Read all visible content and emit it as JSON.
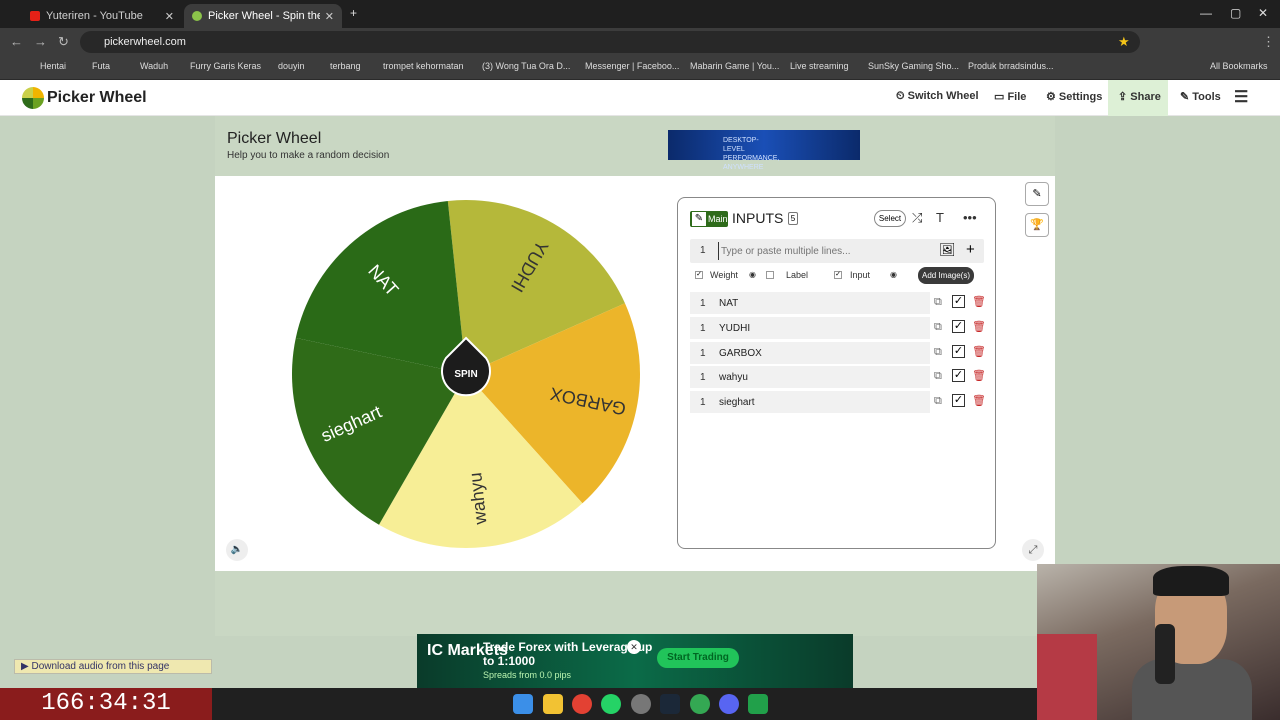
{
  "browser": {
    "tabs": [
      {
        "title": "Yuteriren - YouTube"
      },
      {
        "title": "Picker Wheel - Spin the Wheel"
      }
    ],
    "url": "pickerwheel.com",
    "bookmarks": [
      "Hentai",
      "Futa",
      "Waduh",
      "Furry Garis Keras",
      "douyin",
      "terbang",
      "trompet kehormatan",
      "(3) Wong Tua Ora D...",
      "Messenger | Faceboo...",
      "Mabarin Game | You...",
      "Live streaming",
      "SunSky Gaming Sho...",
      "Produk brradsindus..."
    ],
    "all_bookmarks": "All Bookmarks"
  },
  "site": {
    "brand": "Picker Wheel",
    "nav": {
      "switch": "Switch Wheel",
      "file": "File",
      "settings": "Settings",
      "share": "Share",
      "tools": "Tools"
    },
    "title": "Picker Wheel",
    "subtitle": "Help you to make a random decision"
  },
  "wheel": {
    "spin_label": "SPIN",
    "segments": [
      {
        "label": "YUDHI",
        "color": "#b5b83a"
      },
      {
        "label": "GARBOX",
        "color": "#ecb52a"
      },
      {
        "label": "wahyu",
        "color": "#f7ee96"
      },
      {
        "label": "sieghart",
        "color": "#2f6b18"
      },
      {
        "label": "NAT",
        "color": "#2a6a17"
      }
    ]
  },
  "inputs": {
    "badge": "Main",
    "title": "INPUTS",
    "count": "5",
    "select_label": "Select",
    "entry_number": "1",
    "entry_placeholder": "Type or paste multiple lines...",
    "tooltip": "Add Image(s)",
    "options": {
      "weight": "Weight",
      "label": "Label",
      "input": "Input"
    },
    "rows": [
      {
        "weight": "1",
        "text": "NAT"
      },
      {
        "weight": "1",
        "text": "YUDHI"
      },
      {
        "weight": "1",
        "text": "GARBOX"
      },
      {
        "weight": "1",
        "text": "wahyu"
      },
      {
        "weight": "1",
        "text": "sieghart"
      }
    ]
  },
  "ads": {
    "top_text": "DESKTOP-LEVEL PERFORMANCE, ANYWHERE",
    "bottom_brand": "IC Markets",
    "bottom_headline": "Trade Forex with Leverage up to 1:1000",
    "bottom_sub": "Spreads from 0.0 pips",
    "bottom_cta": "Start Trading"
  },
  "download_bar": "Download audio from this page",
  "timer": "166:34:31"
}
